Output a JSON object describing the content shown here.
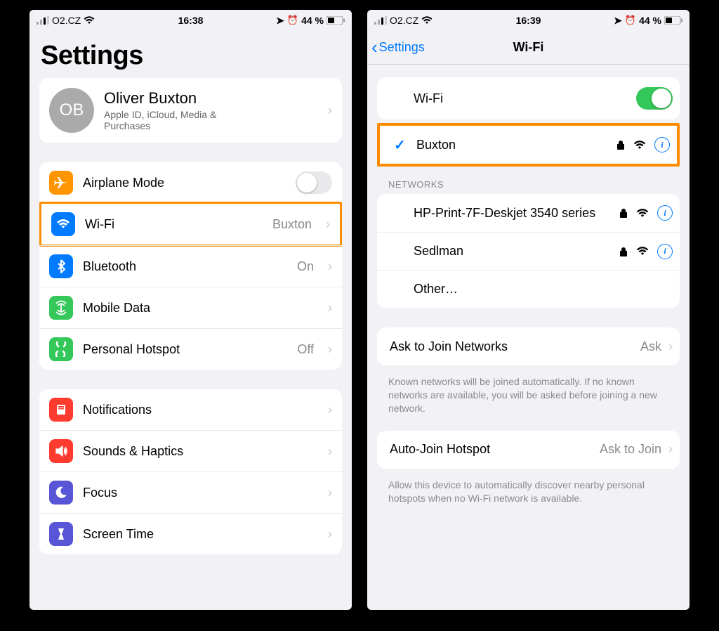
{
  "left": {
    "status": {
      "carrier": "O2.CZ",
      "time": "16:38",
      "battery": "44 %"
    },
    "title": "Settings",
    "profile": {
      "initials": "OB",
      "name": "Oliver Buxton",
      "subtitle": "Apple ID, iCloud, Media & Purchases"
    },
    "group1": [
      {
        "key": "airplane",
        "label": "Airplane Mode",
        "toggle": false,
        "bg": "#ff9500"
      },
      {
        "key": "wifi",
        "label": "Wi-Fi",
        "value": "Buxton",
        "bg": "#007aff",
        "highlight": true
      },
      {
        "key": "bluetooth",
        "label": "Bluetooth",
        "value": "On",
        "bg": "#007aff"
      },
      {
        "key": "mobiledata",
        "label": "Mobile Data",
        "bg": "#34c759"
      },
      {
        "key": "hotspot",
        "label": "Personal Hotspot",
        "value": "Off",
        "bg": "#34c759"
      }
    ],
    "group2": [
      {
        "key": "notifications",
        "label": "Notifications",
        "bg": "#ff3b30"
      },
      {
        "key": "sounds",
        "label": "Sounds & Haptics",
        "bg": "#ff3b30"
      },
      {
        "key": "focus",
        "label": "Focus",
        "bg": "#5856d6"
      },
      {
        "key": "screentime",
        "label": "Screen Time",
        "bg": "#5856d6"
      }
    ]
  },
  "right": {
    "status": {
      "carrier": "O2.CZ",
      "time": "16:39",
      "battery": "44 %"
    },
    "back_label": "Settings",
    "title": "Wi-Fi",
    "wifi_label": "Wi-Fi",
    "wifi_on": true,
    "connected": {
      "name": "Buxton",
      "secured": true
    },
    "networks_header": "NETWORKS",
    "networks": [
      {
        "name": "HP-Print-7F-Deskjet 3540 series",
        "secured": true
      },
      {
        "name": "Sedlman",
        "secured": true
      },
      {
        "name": "Other…",
        "other": true
      }
    ],
    "ask": {
      "label": "Ask to Join Networks",
      "value": "Ask"
    },
    "ask_footer": "Known networks will be joined automatically. If no known networks are available, you will be asked before joining a new network.",
    "auto": {
      "label": "Auto-Join Hotspot",
      "value": "Ask to Join"
    },
    "auto_footer": "Allow this device to automatically discover nearby personal hotspots when no Wi-Fi network is available."
  }
}
